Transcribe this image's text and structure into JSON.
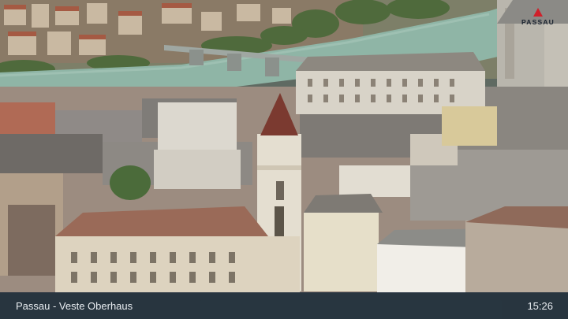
{
  "logo": {
    "text": "PASSAU",
    "accent_color": "#d0202a",
    "icon": "flag-icon"
  },
  "caption": {
    "title": "Passau - Veste Oberhaus",
    "time": "15:26"
  },
  "colors": {
    "river": "#8fb5a6",
    "roofs": "#9a6a58",
    "caption_bg": "#1c2a38"
  }
}
